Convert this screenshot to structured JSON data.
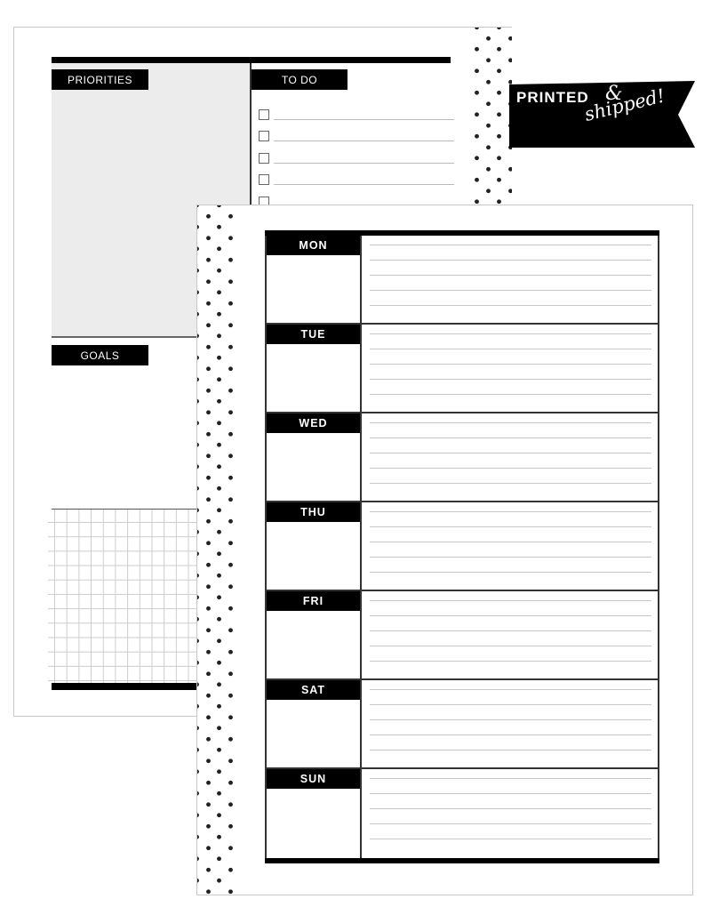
{
  "back_page": {
    "sections": {
      "priorities": "PRIORITIES",
      "todo": "TO DO",
      "goals": "GOALS"
    },
    "todo_items_visible": 5
  },
  "banner": {
    "printed": "PRINTED",
    "ampersand": "&",
    "shipped": "shipped!"
  },
  "front_page": {
    "days": [
      {
        "label": "MON",
        "lines": 5
      },
      {
        "label": "TUE",
        "lines": 5
      },
      {
        "label": "WED",
        "lines": 5
      },
      {
        "label": "THU",
        "lines": 5
      },
      {
        "label": "FRI",
        "lines": 5
      },
      {
        "label": "SAT",
        "lines": 5
      },
      {
        "label": "SUN",
        "lines": 5
      }
    ]
  },
  "colors": {
    "ink": "#000000",
    "panel_gray": "#ececec",
    "rule_gray": "#c8c8c8",
    "paper": "#ffffff"
  }
}
